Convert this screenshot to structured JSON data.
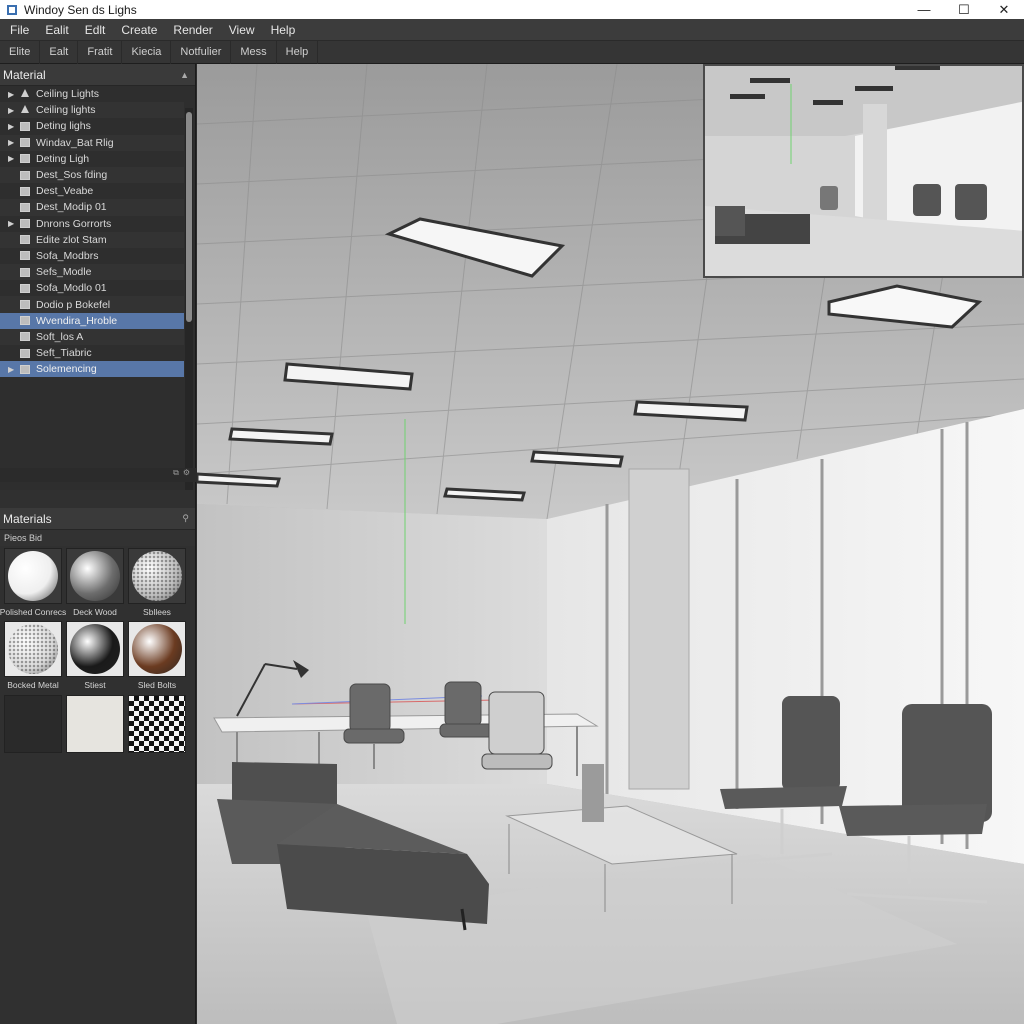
{
  "window": {
    "title": "Windoy Sen ds Lighs",
    "controls": {
      "minimize": "—",
      "maximize": "☐",
      "close": "✕"
    }
  },
  "menu": [
    "File",
    "Ealit",
    "Edlt",
    "Create",
    "Render",
    "View",
    "Help"
  ],
  "toolbar_tabs": [
    "Elite",
    "Ealt",
    "Fratit",
    "Kiecia",
    "Notfulier",
    "Mess",
    "Help"
  ],
  "scene_panel": {
    "title": "Material",
    "items": [
      {
        "label": "Ceiling Lights",
        "expand": true,
        "icon": "light-icon",
        "selected": false
      },
      {
        "label": "Ceiling lights",
        "expand": true,
        "icon": "light-icon",
        "selected": false
      },
      {
        "label": "Deting lighs",
        "expand": true,
        "icon": "object-icon",
        "selected": false
      },
      {
        "label": "Windav_Bat Rlig",
        "expand": true,
        "icon": "object-icon",
        "selected": false
      },
      {
        "label": "Deting Ligh",
        "expand": true,
        "icon": "object-icon",
        "selected": false
      },
      {
        "label": "Dest_Sos fding",
        "expand": false,
        "icon": "object-icon",
        "selected": false
      },
      {
        "label": "Dest_Veabe",
        "expand": false,
        "icon": "object-icon",
        "selected": false
      },
      {
        "label": "Dest_Modip 01",
        "expand": false,
        "icon": "object-icon",
        "selected": false
      },
      {
        "label": "Dnrons Gorrorts",
        "expand": true,
        "icon": "object-icon",
        "selected": false
      },
      {
        "label": "Edite zlot Stam",
        "expand": false,
        "icon": "object-icon",
        "selected": false
      },
      {
        "label": "Sofa_Modbrs",
        "expand": false,
        "icon": "object-icon",
        "selected": false
      },
      {
        "label": "Sefs_Modle",
        "expand": false,
        "icon": "object-icon",
        "selected": false
      },
      {
        "label": "Sofa_Modlo 01",
        "expand": false,
        "icon": "object-icon",
        "selected": false
      },
      {
        "label": "Dodio p Bokefel",
        "expand": false,
        "icon": "object-icon",
        "selected": false
      },
      {
        "label": "Wvendira_Hroble",
        "expand": false,
        "icon": "object-icon",
        "selected": true
      },
      {
        "label": "Soft_los A",
        "expand": false,
        "icon": "object-icon",
        "selected": false
      },
      {
        "label": "Seft_Tiabric",
        "expand": false,
        "icon": "object-icon",
        "selected": false
      },
      {
        "label": "Solemencing",
        "expand": true,
        "icon": "object-icon",
        "selected": true
      }
    ],
    "footer_icons": [
      "⧉",
      "⚙"
    ]
  },
  "materials_panel": {
    "title": "Materials",
    "subtitle": "Pieos Bid",
    "materials": [
      {
        "label": "Polished Conrecs",
        "kind": "ball",
        "color": "#efefef"
      },
      {
        "label": "Deck Wood",
        "kind": "ball",
        "color": "#6d6d6d"
      },
      {
        "label": "Sbllees",
        "kind": "ball",
        "color": "#bdbdbd"
      },
      {
        "label": "Bocked Metal",
        "kind": "ball",
        "color": "#d9d9d9"
      },
      {
        "label": "Stiest",
        "kind": "ball",
        "color": "#1a1a1a"
      },
      {
        "label": "Sled Bolts",
        "kind": "ball",
        "color": "#6b3b21"
      },
      {
        "label": "",
        "kind": "flat",
        "color": "#2a2a2a"
      },
      {
        "label": "",
        "kind": "flat",
        "color": "#e6e4df"
      },
      {
        "label": "",
        "kind": "checker",
        "color": "#111111"
      }
    ]
  },
  "colors": {
    "accent_selection": "#5877a8",
    "panel_bg": "#303030"
  }
}
